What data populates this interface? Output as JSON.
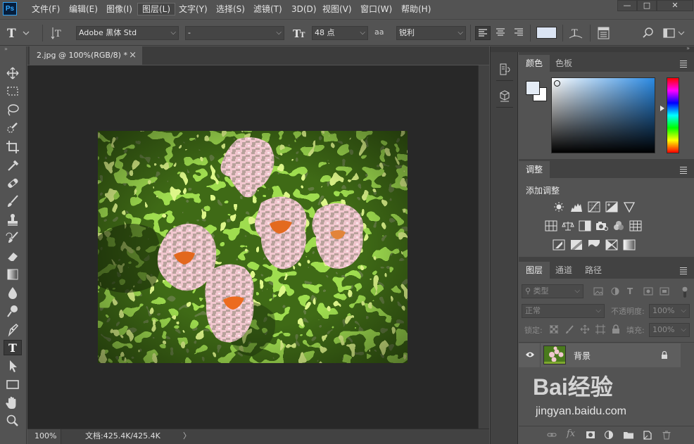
{
  "app": {
    "logo": "Ps"
  },
  "menu": {
    "items": [
      "文件(F)",
      "编辑(E)",
      "图像(I)",
      "图层(L)",
      "文字(Y)",
      "选择(S)",
      "滤镜(T)",
      "3D(D)",
      "视图(V)",
      "窗口(W)",
      "帮助(H)"
    ],
    "active_index": 3
  },
  "window_controls": {
    "minimize": "—",
    "restore": "□",
    "close": "✕"
  },
  "options": {
    "font_family": "Adobe 黑体 Std",
    "font_style": "-",
    "font_size": "48 点",
    "antialias_label": "aa",
    "antialias": "锐利",
    "text_color": "#dbe4f3"
  },
  "document": {
    "tab_title": "2.jpg @ 100%(RGB/8) *",
    "tab_close": "×",
    "zoom": "100%",
    "doc_info": "文档:425.4K/425.4K",
    "status_arrow": "〉"
  },
  "color_panel": {
    "tabs": [
      "颜色",
      "色板"
    ],
    "foreground": "#e4ecf6",
    "background": "#ffffff",
    "hue_base": "#2b8ae3"
  },
  "adjustments_panel": {
    "tab": "调整",
    "title": "添加调整",
    "rows": [
      [
        "brightness-contrast-icon",
        "levels-icon",
        "curves-icon",
        "exposure-icon",
        "vibrance-icon"
      ],
      [
        "hue-saturation-icon",
        "color-balance-icon",
        "black-white-icon",
        "photo-filter-icon",
        "channel-mixer-icon",
        "color-lookup-icon"
      ],
      [
        "invert-icon",
        "posterize-icon",
        "threshold-icon",
        "selective-color-icon",
        "gradient-map-icon"
      ]
    ]
  },
  "layers_panel": {
    "tabs": [
      "图层",
      "通道",
      "路径"
    ],
    "filter_kind": "类型",
    "blend_mode": "正常",
    "opacity_label": "不透明度:",
    "opacity": "100%",
    "lock_label": "锁定:",
    "fill_label": "填充:",
    "fill": "100%",
    "layers": [
      {
        "name": "背景",
        "visible": true,
        "locked": true
      }
    ],
    "footer_fx": "fx"
  },
  "watermark": {
    "text": "Bai经验",
    "url": "jingyan.baidu.com"
  }
}
